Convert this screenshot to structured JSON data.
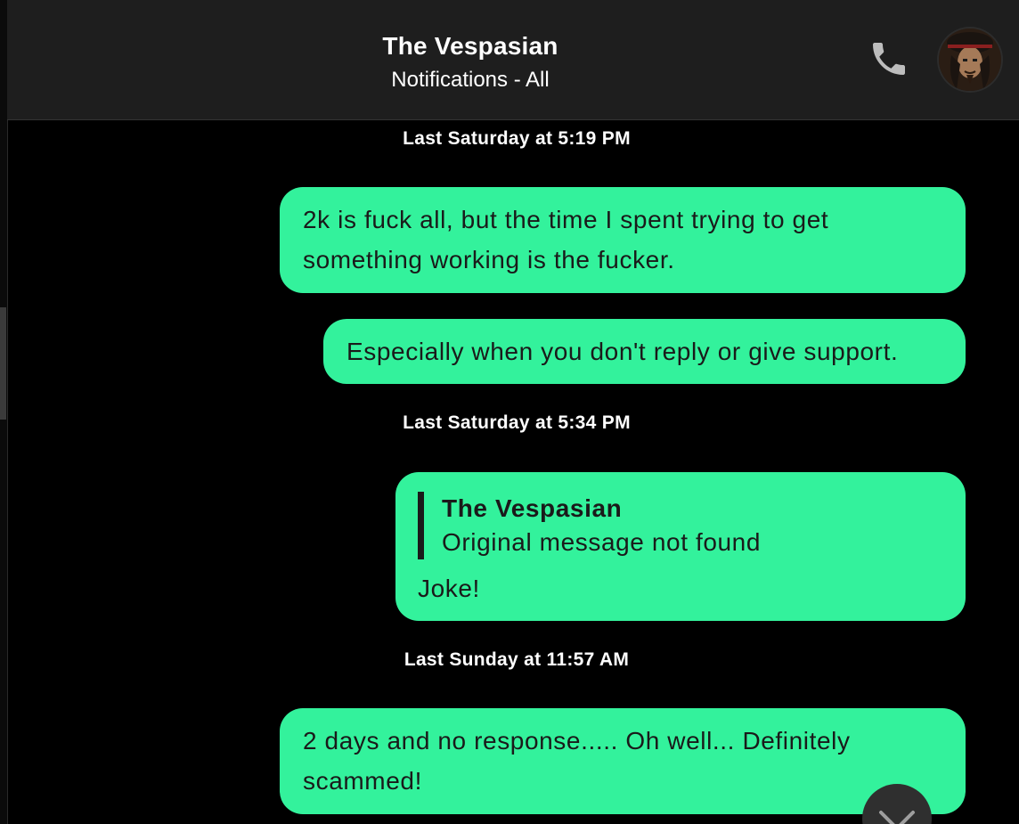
{
  "header": {
    "title": "The Vespasian",
    "subtitle": "Notifications - All"
  },
  "colors": {
    "bubble": "#33f29c",
    "header_bg": "#1e1e1e",
    "background": "#000000"
  },
  "icons": {
    "call": "phone-icon",
    "avatar": "avatar",
    "scroll_down": "chevron-down-icon"
  },
  "messages": {
    "ts1": "Last Saturday at 5:19 PM",
    "m1_line1": "2k is fuck all, but the time I spent trying to get",
    "m1_line2": "something working is the fucker.",
    "m2": "Especially when you don't reply or give support.",
    "ts2": "Last Saturday at 5:34 PM",
    "m3_quote_name": "The Vespasian",
    "m3_quote_body": "Original message not found",
    "m3_text": "Joke!",
    "ts3": "Last Sunday at 11:57 AM",
    "m4_line1": "2 days and no response..... Oh well... Definitely",
    "m4_line2": "scammed!"
  }
}
